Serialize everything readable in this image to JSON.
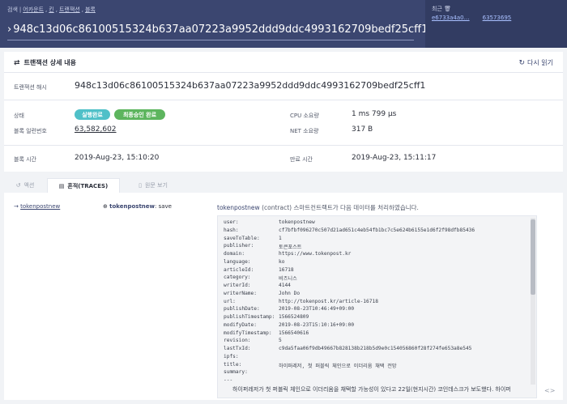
{
  "header": {
    "crumbs": [
      "검색",
      "어카운트",
      "킨",
      "트랜잭션",
      "블록"
    ],
    "search_value": "948c13d06c86100515324b637aa07223a9952ddd9ddc4993162709bedf25cff1",
    "recent_title": "최근",
    "recent_links": [
      "e6733a4a0…",
      "63573695"
    ]
  },
  "detail": {
    "title": "트랜잭션 상세 내용",
    "reload": "다시 읽기",
    "hash_label": "트랜잭션 해시",
    "hash_value": "948c13d06c86100515324b637aa07223a9952ddd9ddc4993162709bedf25cff1",
    "status_label": "상태",
    "status_exec": "실행완료",
    "status_final": "최종승인 완료",
    "cpu_label": "CPU 소요량",
    "cpu_value": "1 ms 799 μs",
    "block_label": "블록 일련번호",
    "block_value": "63,582,602",
    "net_label": "NET 소요량",
    "net_value": "317 B",
    "block_time_label": "블록 시간",
    "block_time_value": "2019-Aug-23, 15:10:20",
    "expire_label": "만료 시간",
    "expire_value": "2019-Aug-23, 15:11:17"
  },
  "tabs": [
    {
      "label": "액션",
      "icon": "history-icon"
    },
    {
      "label": "흔적(TRACES)",
      "icon": "list-icon"
    },
    {
      "label": "원문 보기",
      "icon": "document-icon"
    }
  ],
  "trace": {
    "from": "tokenpostnew",
    "call_account": "tokenpostnew",
    "call_action": ": save",
    "desc_account": "tokenpostnew",
    "desc_contract": " (contract) ",
    "desc_text": "스마트컨트랙트가 다음 데이터를 처리하였습니다.",
    "fields": [
      {
        "k": "user:",
        "v": "tokenpostnew"
      },
      {
        "k": "hash:",
        "v": "cf7bfbf096270c507d21ad651c4eb54fb1bc7c5e624b6155e1d6f2f98dfb85436"
      },
      {
        "k": "saveToTable:",
        "v": "1"
      },
      {
        "k": "publisher:",
        "v": "토큰포스트"
      },
      {
        "k": "domain:",
        "v": "https://www.tokenpost.kr"
      },
      {
        "k": "language:",
        "v": "ko"
      },
      {
        "k": "articleId:",
        "v": "16718"
      },
      {
        "k": "category:",
        "v": "비즈니스"
      },
      {
        "k": "writerId:",
        "v": "4144"
      },
      {
        "k": "writerName:",
        "v": "John Do"
      },
      {
        "k": "url:",
        "v": "http://tokenpost.kr/article-16718"
      },
      {
        "k": "publishDate:",
        "v": "2019-08-23T10:46:49+09:00"
      },
      {
        "k": "publishTimestamp:",
        "v": "1566524809"
      },
      {
        "k": "modifyDate:",
        "v": "2019-08-23T15:10:16+09:00"
      },
      {
        "k": "modifyTimestamp:",
        "v": "1566540616"
      },
      {
        "k": "revision:",
        "v": "5"
      },
      {
        "k": "lastTxId:",
        "v": "c9da5faa06f9db49667b828138b218b5d9e0c154056860f28f274fe653a8e545"
      },
      {
        "k": "ipfs:",
        "v": ""
      },
      {
        "k": "title:",
        "v": "하이퍼레저, 첫 퍼블릭 체인으로 이더리움 채택 전망"
      },
      {
        "k": "summary:",
        "v": ""
      },
      {
        "k": "---",
        "v": ""
      }
    ],
    "summary_text": "하이퍼레저가 첫 퍼블릭 체인으로 이더리움을 채택할 가능성이 있다고 22일(현지시간) 코인데스크가 보도했다. 하이퍼"
  },
  "scroll_position": 0.02
}
